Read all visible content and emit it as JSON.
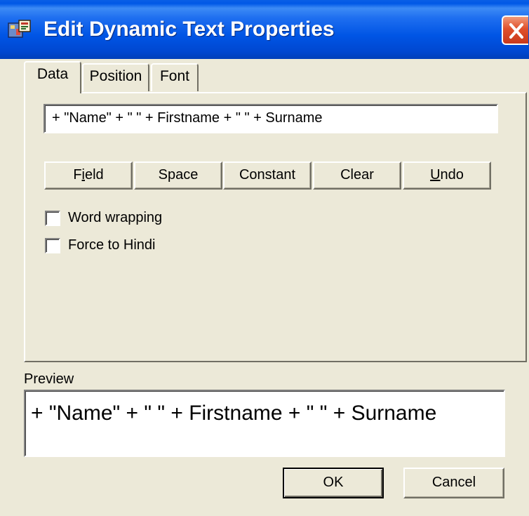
{
  "window": {
    "title": "Edit Dynamic Text Properties",
    "icon": "app-icon",
    "close_icon": "close-icon"
  },
  "tabs": [
    {
      "label": "Data",
      "selected": true
    },
    {
      "label": "Position",
      "selected": false
    },
    {
      "label": "Font",
      "selected": false
    }
  ],
  "data_tab": {
    "expression_value": "+ \"Name\" + \" \" + Firstname + \" \" + Surname",
    "buttons": {
      "field": {
        "before": "F",
        "accel": "i",
        "after": "eld"
      },
      "space": "Space",
      "constant": "Constant",
      "clear": "Clear",
      "undo": {
        "accel": "U",
        "after": "ndo"
      }
    },
    "checkboxes": [
      {
        "label": "Word wrapping",
        "checked": false
      },
      {
        "label": "Force to Hindi",
        "checked": false
      }
    ]
  },
  "preview": {
    "label": "Preview",
    "text": "+ \"Name\" + \" \" + Firstname + \" \" + Surname"
  },
  "footer": {
    "ok_label": "OK",
    "cancel_label": "Cancel"
  },
  "colors": {
    "titlebar": "#0055e5",
    "dialog_bg": "#ece9d8",
    "close_button": "#e0502c"
  }
}
